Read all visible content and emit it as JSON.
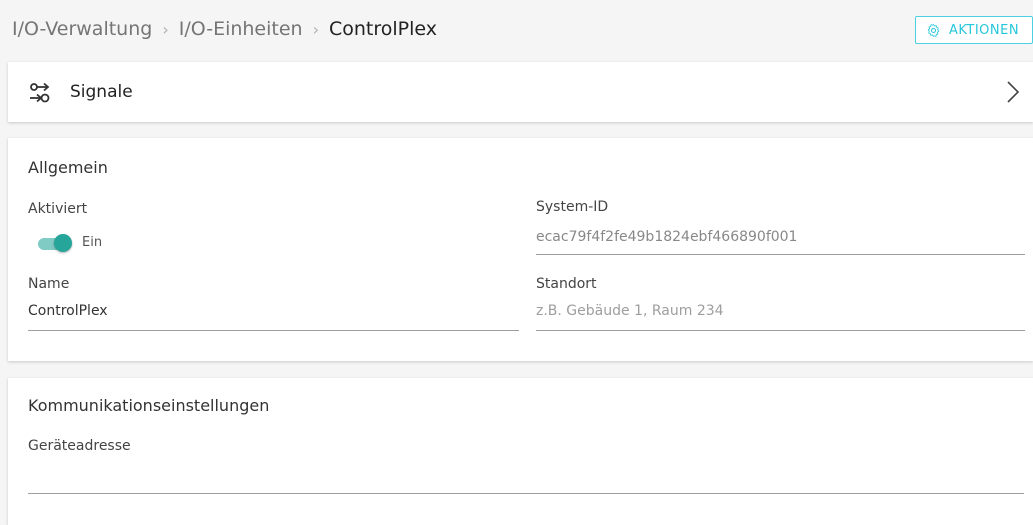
{
  "breadcrumb": {
    "items": [
      "I/O-Verwaltung",
      "I/O-Einheiten"
    ],
    "current": "ControlPlex",
    "separator": "›"
  },
  "actions_button": {
    "label": "AKTIONEN",
    "icon": "gear-icon"
  },
  "signals": {
    "label": "Signale",
    "icon": "signals-icon"
  },
  "general": {
    "title": "Allgemein",
    "activated": {
      "label": "Aktiviert",
      "state_label": "Ein",
      "on": true
    },
    "system_id": {
      "label": "System-ID",
      "value": "ecac79f4f2fe49b1824ebf466890f001"
    },
    "name": {
      "label": "Name",
      "value": "ControlPlex"
    },
    "location": {
      "label": "Standort",
      "placeholder": "z.B. Gebäude 1, Raum 234"
    }
  },
  "communication": {
    "title": "Kommunikationseinstellungen",
    "device_address": {
      "label": "Geräteadresse",
      "value": ""
    }
  },
  "colors": {
    "accent": "#26c6da",
    "toggle": "#26a69a"
  }
}
